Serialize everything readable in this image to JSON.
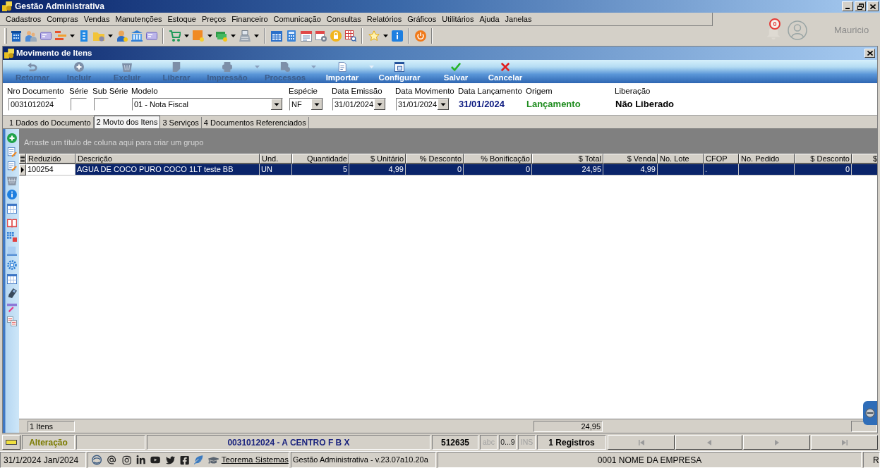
{
  "app_window": {
    "title": "Gestão Administrativa"
  },
  "menu": [
    "Cadastros",
    "Compras",
    "Vendas",
    "Manutenções",
    "Estoque",
    "Preços",
    "Financeiro",
    "Comunicação",
    "Consultas",
    "Relatórios",
    "Gráficos",
    "Utilitários",
    "Ajuda",
    "Janelas"
  ],
  "notifications": {
    "count": "0"
  },
  "user": {
    "name": "Mauricio"
  },
  "document_window": {
    "title": "Movimento de Itens"
  },
  "actions": [
    {
      "label": "Retornar",
      "disabled": true,
      "dropdown": false
    },
    {
      "label": "Incluir",
      "disabled": true,
      "dropdown": false
    },
    {
      "label": "Excluir",
      "disabled": true,
      "dropdown": false
    },
    {
      "label": "Liberar",
      "disabled": true,
      "dropdown": false
    },
    {
      "label": "Impressão",
      "disabled": true,
      "dropdown": true
    },
    {
      "label": "Processos",
      "disabled": true,
      "dropdown": true
    },
    {
      "label": "Importar",
      "disabled": false,
      "dropdown": true
    },
    {
      "label": "Configurar",
      "disabled": false,
      "dropdown": false
    },
    {
      "label": "Salvar",
      "disabled": false,
      "dropdown": false
    },
    {
      "label": "Cancelar",
      "disabled": false,
      "dropdown": false
    }
  ],
  "fields": [
    {
      "kind": "input",
      "label": "Nro Documento",
      "value": "0031012024"
    },
    {
      "kind": "input",
      "label": "Série"
    },
    {
      "kind": "input",
      "label": "Sub Série"
    },
    {
      "kind": "select",
      "label": "Modelo",
      "value": "01 - Nota Fiscal"
    },
    {
      "kind": "select",
      "label": "Espécie",
      "value": "NF"
    },
    {
      "kind": "select",
      "label": "Data Emissão",
      "value": "31/01/2024"
    },
    {
      "kind": "select",
      "label": "Data Movimento",
      "value": "31/01/2024"
    },
    {
      "kind": "display",
      "label": "Data Lançamento",
      "value": "31/01/2024",
      "color": "#0c1a80"
    },
    {
      "kind": "display",
      "label": "Origem",
      "value": "Lançamento",
      "color": "#1e8c1e"
    },
    {
      "kind": "display",
      "label": "Liberação",
      "value": "Não Liberado",
      "color": "#000000"
    }
  ],
  "tabs": [
    {
      "label": "1 Dados do Documento",
      "selected": false
    },
    {
      "label": "2 Movto dos Itens",
      "selected": true
    },
    {
      "label": "3 Serviços",
      "selected": false
    },
    {
      "label": "4 Documentos Referenciados",
      "selected": false
    }
  ],
  "grid": {
    "group_hint": "Arraste um título de coluna aqui para criar um grupo",
    "columns": [
      {
        "label": "Reduzido",
        "kind": "text"
      },
      {
        "label": "Descrição",
        "kind": "text"
      },
      {
        "label": "Und.",
        "kind": "text"
      },
      {
        "label": "Quantidade",
        "kind": "number"
      },
      {
        "label": "$ Unitário",
        "kind": "number"
      },
      {
        "label": "% Desconto",
        "kind": "number"
      },
      {
        "label": "% Bonificação",
        "kind": "number"
      },
      {
        "label": "$ Total",
        "kind": "number"
      },
      {
        "label": "$ Venda",
        "kind": "number"
      },
      {
        "label": "No. Lote",
        "kind": "text"
      },
      {
        "label": "CFOP",
        "kind": "text"
      },
      {
        "label": "No. Pedido",
        "kind": "text"
      },
      {
        "label": "$ Desconto",
        "kind": "number"
      },
      {
        "label": "$",
        "kind": "number"
      }
    ],
    "rows": [
      {
        "selected": true,
        "cells": [
          {
            "text": "100254",
            "focused": true
          },
          {
            "text": "AGUA DE COCO PURO COCO 1LT teste BB",
            "focused": false
          },
          {
            "text": "UN",
            "focused": false
          },
          {
            "text": "5",
            "focused": false
          },
          {
            "text": "4,99",
            "focused": false
          },
          {
            "text": "0",
            "focused": false
          },
          {
            "text": "0",
            "focused": false
          },
          {
            "text": "24,95",
            "focused": false
          },
          {
            "text": "4,99",
            "focused": false
          },
          {
            "focused": false
          },
          {
            "text": ".",
            "focused": false
          },
          {
            "focused": false
          },
          {
            "text": "0",
            "focused": false
          },
          {
            "focused": false
          }
        ]
      }
    ],
    "footer": {
      "count": "1 Itens",
      "total": "24,95"
    }
  },
  "status_bar": {
    "mode": "Alteração",
    "document": "0031012024 - A CENTRO F B X",
    "code": "512635",
    "indicators": [
      {
        "label": "abc",
        "active": false
      },
      {
        "label": "0...9",
        "active": true
      },
      {
        "label": "INS",
        "active": false
      }
    ],
    "records": "1 Registros"
  },
  "info_bar": {
    "date": "31/1/2024 Jan/2024",
    "link": "Teorema Sistemas",
    "version": "Gestão Administrativa - v.23.07a10.20a",
    "company": "0001 NOME DA EMPRESA",
    "cut_panel": "R"
  }
}
